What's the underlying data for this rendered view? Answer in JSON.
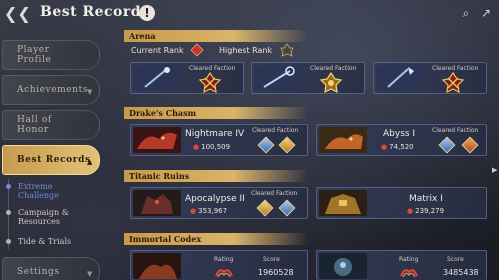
{
  "header": {
    "title": "Best Records",
    "back_icon": "back-arrow-icon",
    "info_icon": "!"
  },
  "sidebar": {
    "items": [
      {
        "label": "Player\nProfile"
      },
      {
        "label": "Achievements"
      },
      {
        "label": "Hall of\nHonor"
      },
      {
        "label": "Best Records"
      },
      {
        "label": "Settings"
      }
    ],
    "sub_items": [
      {
        "label": "Extreme\nChallenge"
      },
      {
        "label": "Campaign &\nResources"
      },
      {
        "label": "Tide & Trials"
      }
    ]
  },
  "arena": {
    "title": "Arena",
    "current_rank_label": "Current Rank",
    "highest_rank_label": "Highest Rank",
    "cards": [
      {
        "faction_label": "Cleared Faction"
      },
      {
        "faction_label": "Cleared Faction"
      },
      {
        "faction_label": "Cleared Faction"
      }
    ]
  },
  "drakes_chasm": {
    "title": "Drake's Chasm",
    "cards": [
      {
        "name": "Nightmare IV",
        "value": "100,509",
        "faction_label": "Cleared Faction"
      },
      {
        "name": "Abyss I",
        "value": "74,520",
        "faction_label": "Cleared Faction"
      }
    ]
  },
  "titanic_ruins": {
    "title": "Titanic Ruins",
    "cards": [
      {
        "name": "Apocalypse II",
        "value": "353,967",
        "faction_label": "Cleared Faction"
      },
      {
        "name": "Matrix I",
        "value": "239,279"
      }
    ]
  },
  "immortal_codex": {
    "title": "Immortal Codex",
    "cards": [
      {
        "rating_label": "Rating",
        "score_label": "Score",
        "score": "1960528"
      },
      {
        "rating_label": "Rating",
        "score_label": "Score",
        "score": "3485438"
      }
    ]
  },
  "colors": {
    "accent_gold": "#d9b46a",
    "card_blue": "#343c58",
    "drop_red": "#d64b3b"
  }
}
